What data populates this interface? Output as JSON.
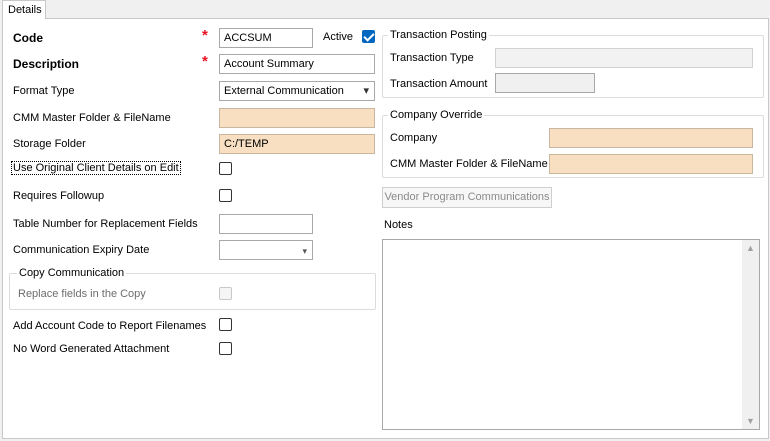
{
  "tabs": [
    {
      "label": "Details"
    }
  ],
  "form": {
    "code": {
      "label": "Code",
      "required_mark": "*",
      "value": "ACCSUM"
    },
    "active": {
      "label": "Active",
      "checked": true
    },
    "description": {
      "label": "Description",
      "required_mark": "*",
      "value": "Account Summary"
    },
    "format_type": {
      "label": "Format Type",
      "value": "External Communication"
    },
    "cmm_master": {
      "label": "CMM Master Folder & FileName",
      "value": ""
    },
    "storage_folder": {
      "label": "Storage Folder",
      "value": "C:/TEMP"
    },
    "use_original": {
      "label": "Use Original Client Details on Edit",
      "checked": false
    },
    "requires_followup": {
      "label": "Requires Followup",
      "checked": false
    },
    "table_number": {
      "label": "Table Number for Replacement Fields",
      "value": ""
    },
    "expiry_date": {
      "label": "Communication Expiry Date",
      "value": ""
    },
    "copy_group": {
      "title": "Copy Communication",
      "replace_label": "Replace fields in the Copy",
      "checked": false
    },
    "add_account_code": {
      "label": "Add Account Code to Report Filenames",
      "checked": false
    },
    "no_word": {
      "label": "No Word Generated Attachment",
      "checked": false
    }
  },
  "transaction_posting": {
    "title": "Transaction Posting",
    "type_label": "Transaction Type",
    "type_value": "",
    "amount_label": "Transaction Amount",
    "amount_value": ""
  },
  "company_override": {
    "title": "Company Override",
    "company_label": "Company",
    "company_value": "",
    "cmm_label": "CMM Master Folder & FileName",
    "cmm_value": ""
  },
  "vendor_button": {
    "label": "Vendor Program Communications"
  },
  "notes": {
    "label": "Notes",
    "value": ""
  },
  "icons": {
    "dropdown": "▾",
    "scroll_up": "▲",
    "scroll_down": "▼"
  }
}
